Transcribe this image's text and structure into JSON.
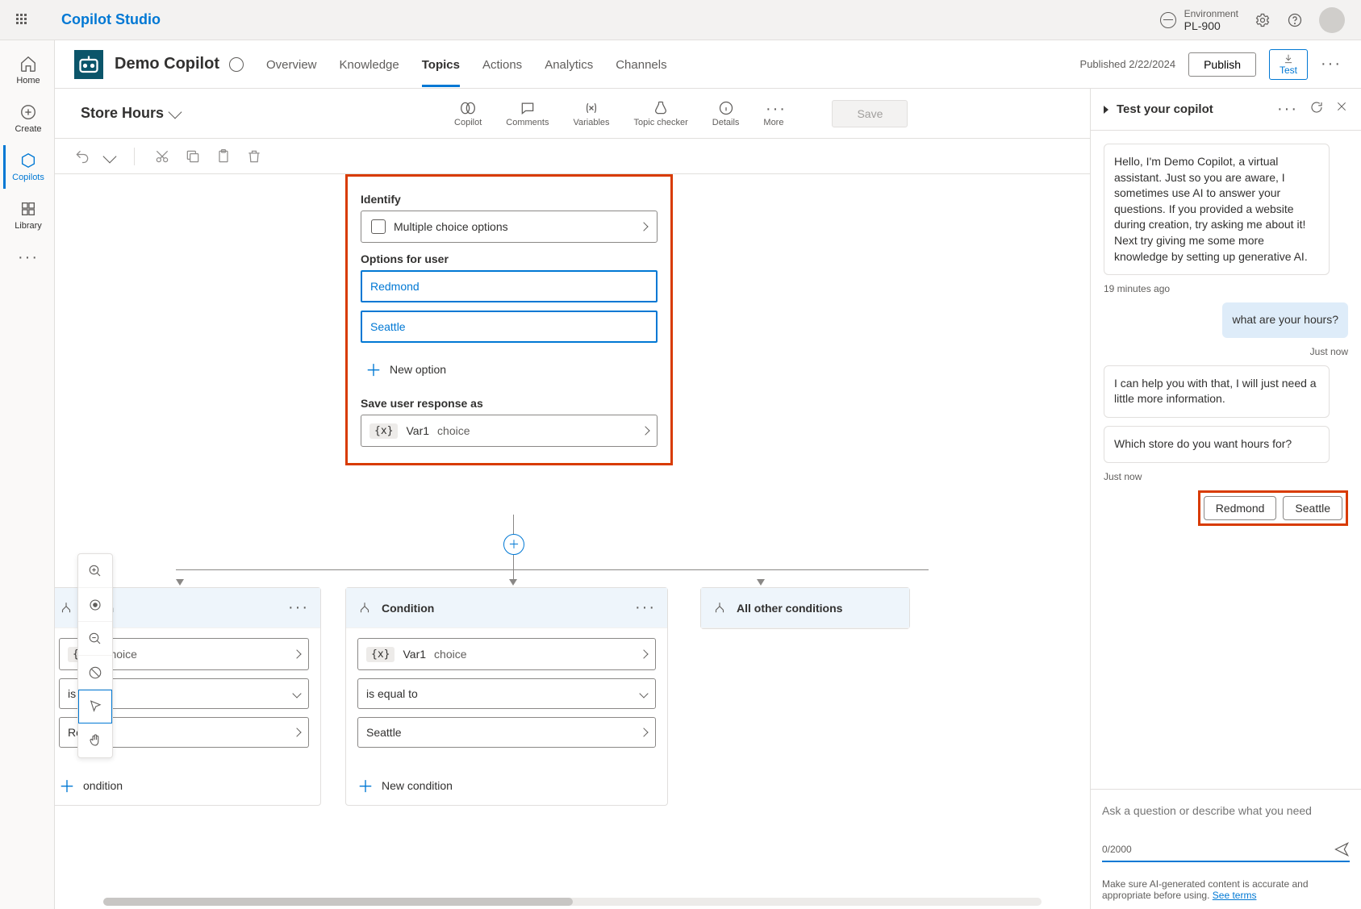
{
  "brand": "Copilot Studio",
  "environment": {
    "label": "Environment",
    "value": "PL-900"
  },
  "rail": {
    "home": "Home",
    "create": "Create",
    "copilots": "Copilots",
    "library": "Library"
  },
  "bot": {
    "name": "Demo Copilot"
  },
  "tabs": {
    "overview": "Overview",
    "knowledge": "Knowledge",
    "topics": "Topics",
    "actions": "Actions",
    "analytics": "Analytics",
    "channels": "Channels"
  },
  "header": {
    "published": "Published 2/22/2024",
    "publish": "Publish",
    "test": "Test"
  },
  "topic": {
    "name": "Store Hours",
    "tools": {
      "copilot": "Copilot",
      "comments": "Comments",
      "variables": "Variables",
      "checker": "Topic checker",
      "details": "Details",
      "more": "More"
    },
    "save": "Save"
  },
  "question_node": {
    "identify_label": "Identify",
    "identify_value": "Multiple choice options",
    "options_label": "Options for user",
    "option1": "Redmond",
    "option2": "Seattle",
    "new_option": "New option",
    "save_label": "Save user response as",
    "var_name": "Var1",
    "var_type": "choice"
  },
  "conditions": {
    "title": "Condition",
    "other_title": "All other conditions",
    "var_name": "Var1",
    "var_type": "choice",
    "op": "is equal to",
    "val1": "Redmond",
    "val2": "Seattle",
    "new_condition": "New condition",
    "partial_title": "dition",
    "partial_op": "is eq",
    "partial_val": "Red",
    "partial_new": "ondition"
  },
  "test_panel": {
    "title": "Test your copilot",
    "welcome": "Hello, I'm Demo Copilot, a virtual assistant. Just so you are aware, I sometimes use AI to answer your questions. If you provided a website during creation, try asking me about it! Next try giving me some more knowledge by setting up generative AI.",
    "ts1": "19 minutes ago",
    "user_msg": "what are your hours?",
    "ts2": "Just now",
    "reply1": "I can help you with that, I will just need a little more information.",
    "reply2": "Which store do you want hours for?",
    "ts3": "Just now",
    "chip1": "Redmond",
    "chip2": "Seattle",
    "placeholder": "Ask a question or describe what you need",
    "counter": "0/2000",
    "disclaimer": "Make sure AI-generated content is accurate and appropriate before using. ",
    "terms": "See terms"
  }
}
